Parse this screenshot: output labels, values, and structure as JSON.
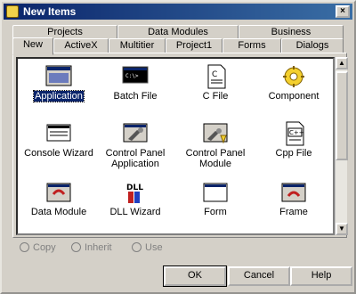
{
  "window": {
    "title": "New Items",
    "close_glyph": "×"
  },
  "tabs_back": [
    "Projects",
    "Data Modules",
    "Business"
  ],
  "tabs_front": [
    "New",
    "ActiveX",
    "Multitier",
    "Project1",
    "Forms",
    "Dialogs"
  ],
  "items": [
    {
      "label": "Application",
      "icon": "application-icon",
      "selected": true
    },
    {
      "label": "Batch File",
      "icon": "batch-file-icon"
    },
    {
      "label": "C File",
      "icon": "c-file-icon"
    },
    {
      "label": "Component",
      "icon": "component-icon"
    },
    {
      "label": "Console Wizard",
      "icon": "console-wizard-icon"
    },
    {
      "label": "Control Panel Application",
      "icon": "control-panel-application-icon"
    },
    {
      "label": "Control Panel Module",
      "icon": "control-panel-module-icon"
    },
    {
      "label": "Cpp File",
      "icon": "cpp-file-icon"
    },
    {
      "label": "Data Module",
      "icon": "data-module-icon"
    },
    {
      "label": "DLL Wizard",
      "icon": "dll-wizard-icon"
    },
    {
      "label": "Form",
      "icon": "form-icon"
    },
    {
      "label": "Frame",
      "icon": "frame-icon"
    }
  ],
  "options": {
    "copy": "Copy",
    "inherit": "Inherit",
    "use": "Use"
  },
  "buttons": {
    "ok": "OK",
    "cancel": "Cancel",
    "help": "Help"
  },
  "icon_texts": {
    "cpp": "C++",
    "dll": "DLL"
  }
}
